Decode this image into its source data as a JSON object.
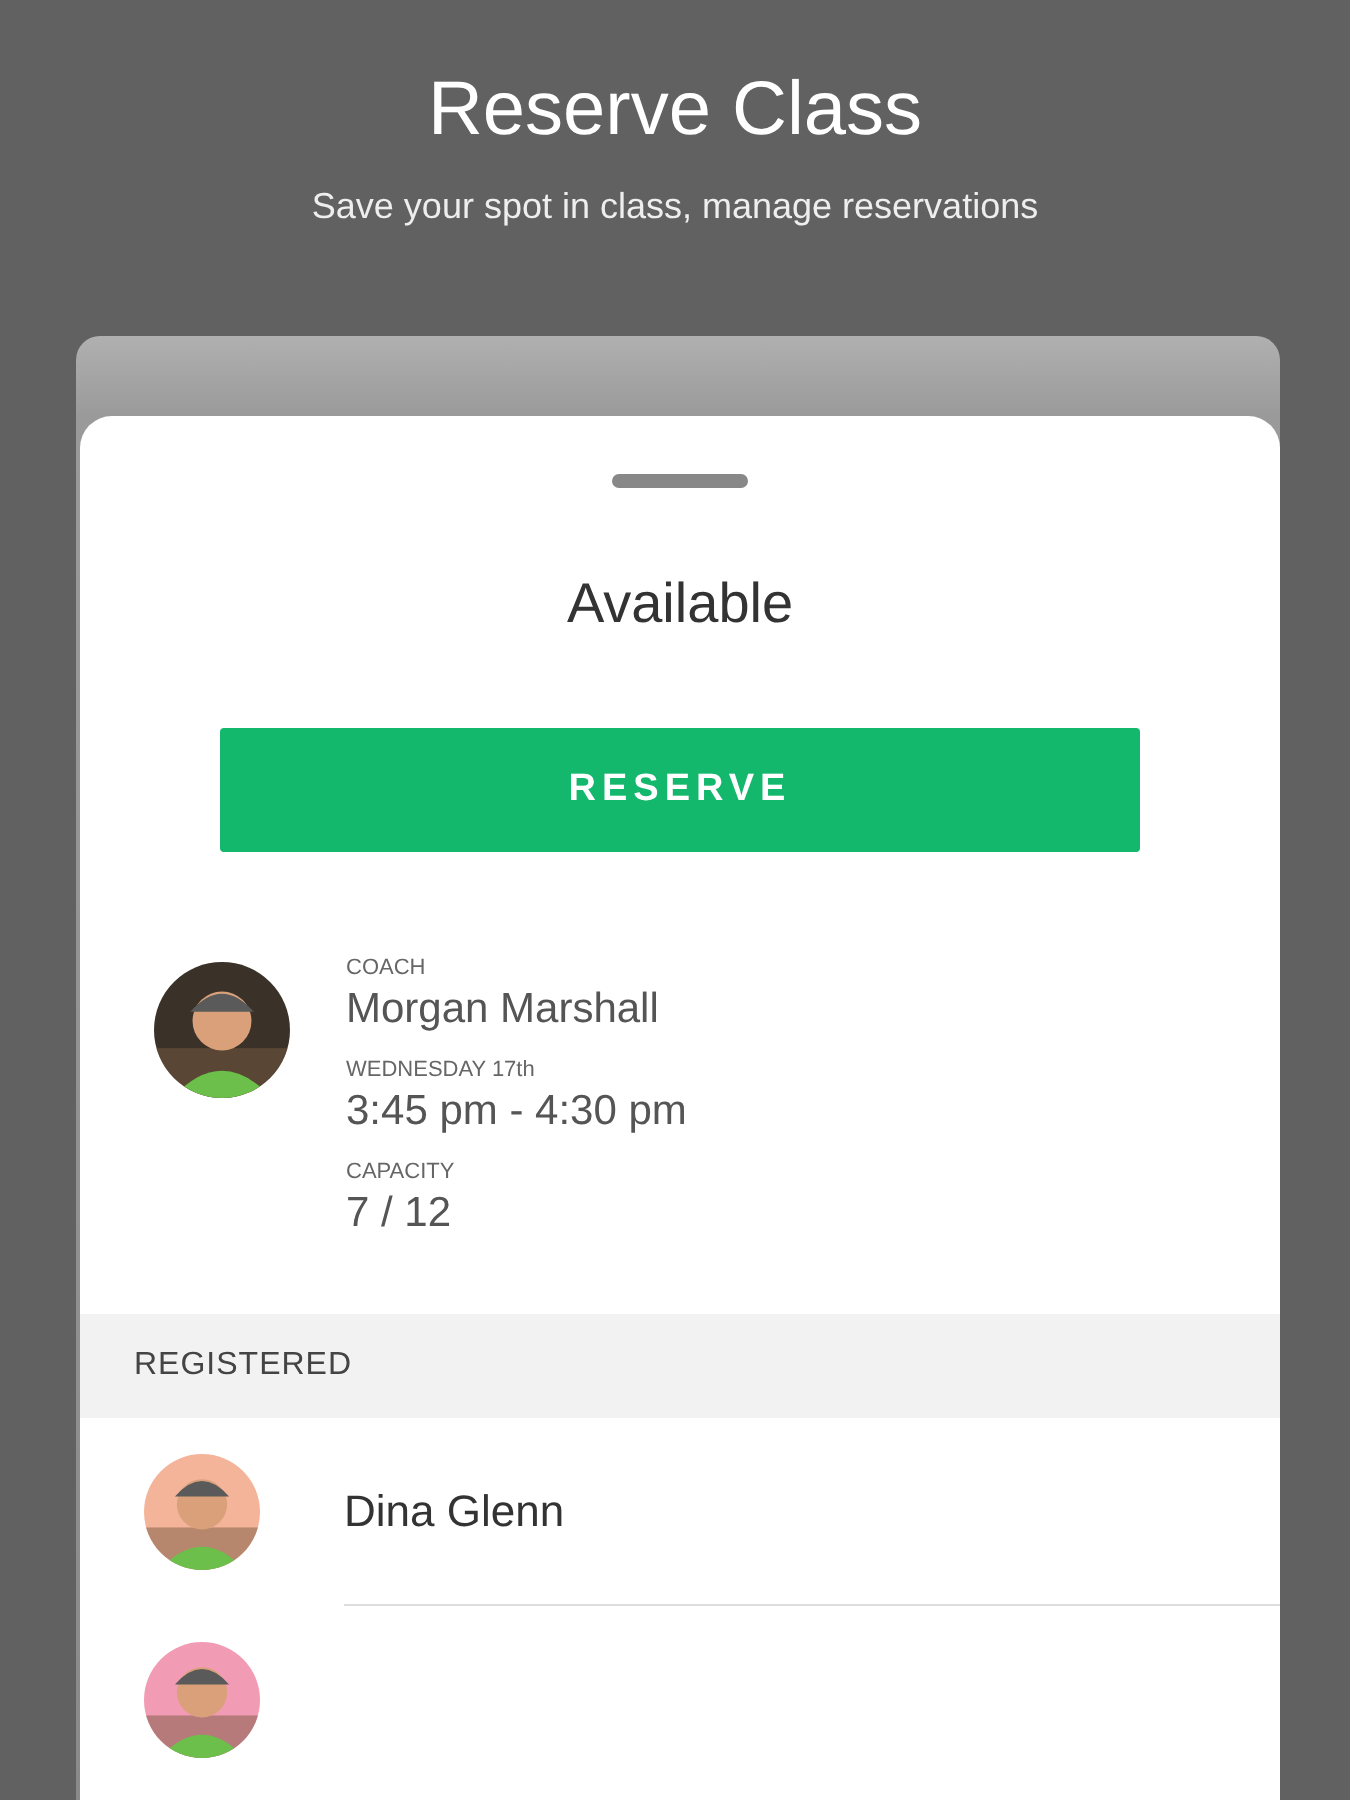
{
  "header": {
    "title": "Reserve Class",
    "subtitle": "Save your spot in class, manage reservations"
  },
  "sheet": {
    "status": "Available",
    "action": "RESERVE"
  },
  "details": [
    {
      "label": "COACH",
      "value": "Morgan Marshall"
    },
    {
      "label": "WEDNESDAY 17th",
      "value": "3:45 pm - 4:30 pm"
    },
    {
      "label": "CAPACITY",
      "value": "7 / 12"
    }
  ],
  "registered": {
    "heading": "REGISTERED",
    "people": [
      {
        "name": "Dina Glenn",
        "color": "#f4b49a"
      },
      {
        "color": "#f29bb5"
      }
    ]
  }
}
